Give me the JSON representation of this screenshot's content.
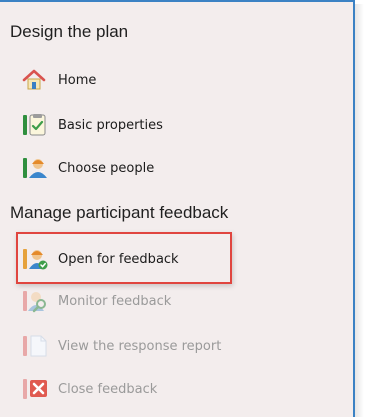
{
  "sections": [
    {
      "heading": "Design the plan",
      "items": [
        {
          "label": "Home",
          "icon": "home-icon",
          "state": "active"
        },
        {
          "label": "Basic properties",
          "icon": "properties-icon",
          "state": "active"
        },
        {
          "label": "Choose people",
          "icon": "people-icon",
          "state": "active"
        }
      ]
    },
    {
      "heading": "Manage participant feedback",
      "items": [
        {
          "label": "Open for feedback",
          "icon": "open-feedback-icon",
          "state": "active",
          "highlighted": true
        },
        {
          "label": "Monitor feedback",
          "icon": "monitor-feedback-icon",
          "state": "disabled"
        },
        {
          "label": "View the response report",
          "icon": "report-icon",
          "state": "disabled"
        },
        {
          "label": "Close feedback",
          "icon": "close-feedback-icon",
          "state": "disabled"
        }
      ]
    }
  ],
  "colors": {
    "panel_bg": "#f3eded",
    "border_blue": "#3b82c4",
    "highlight_red": "#e0453f",
    "active_text": "#1b1b1b",
    "disabled_text": "#9a9a9a"
  }
}
